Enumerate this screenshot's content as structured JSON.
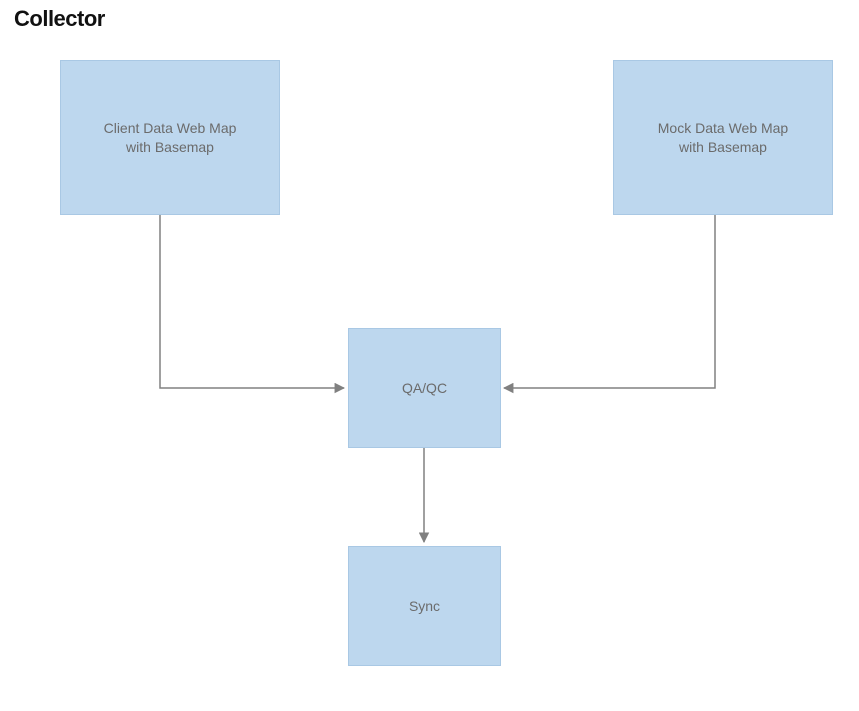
{
  "title": "Collector",
  "nodes": {
    "client": {
      "label": "Client Data Web Map\nwith Basemap"
    },
    "mock": {
      "label": "Mock Data Web Map\nwith Basemap"
    },
    "qaqc": {
      "label": "QA/QC"
    },
    "sync": {
      "label": "Sync"
    }
  },
  "colors": {
    "node_fill": "#bdd7ee",
    "node_border": "#a9c8e4",
    "text": "#6b6b6b",
    "connector": "#808080"
  },
  "chart_data": {
    "type": "flowchart",
    "title": "Collector",
    "nodes": [
      {
        "id": "client",
        "label": "Client Data Web Map with Basemap"
      },
      {
        "id": "mock",
        "label": "Mock Data Web Map with Basemap"
      },
      {
        "id": "qaqc",
        "label": "QA/QC"
      },
      {
        "id": "sync",
        "label": "Sync"
      }
    ],
    "edges": [
      {
        "from": "client",
        "to": "qaqc"
      },
      {
        "from": "mock",
        "to": "qaqc"
      },
      {
        "from": "qaqc",
        "to": "sync"
      }
    ]
  }
}
